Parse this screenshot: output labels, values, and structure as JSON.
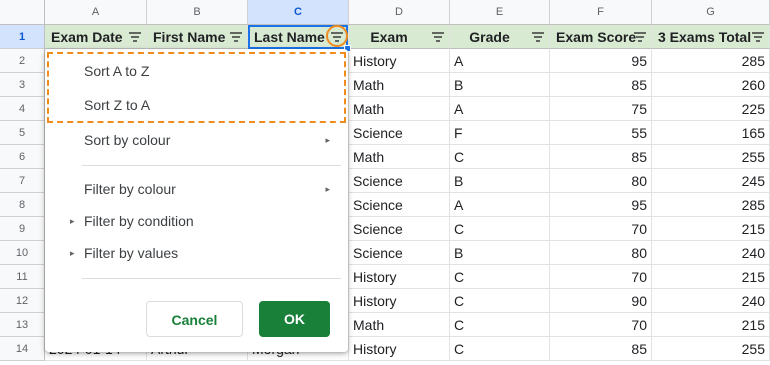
{
  "columns": [
    "A",
    "B",
    "C",
    "D",
    "E",
    "F",
    "G"
  ],
  "selected_column": "C",
  "selected_row": "1",
  "header_row": {
    "row_number": "1",
    "cells": [
      "Exam Date",
      "First Name",
      "Last Name",
      "Exam",
      "Grade",
      "Exam Score",
      "3 Exams Total"
    ]
  },
  "rows": [
    {
      "n": "2",
      "exam": "History",
      "grade": "A",
      "score": "95",
      "total": "285"
    },
    {
      "n": "3",
      "exam": "Math",
      "grade": "B",
      "score": "85",
      "total": "260"
    },
    {
      "n": "4",
      "exam": "Math",
      "grade": "A",
      "score": "75",
      "total": "225"
    },
    {
      "n": "5",
      "exam": "Science",
      "grade": "F",
      "score": "55",
      "total": "165"
    },
    {
      "n": "6",
      "exam": "Math",
      "grade": "C",
      "score": "85",
      "total": "255"
    },
    {
      "n": "7",
      "exam": "Science",
      "grade": "B",
      "score": "80",
      "total": "245"
    },
    {
      "n": "8",
      "exam": "Science",
      "grade": "A",
      "score": "95",
      "total": "285"
    },
    {
      "n": "9",
      "exam": "Science",
      "grade": "C",
      "score": "70",
      "total": "215"
    },
    {
      "n": "10",
      "exam": "Science",
      "grade": "B",
      "score": "80",
      "total": "240"
    },
    {
      "n": "11",
      "exam": "History",
      "grade": "C",
      "score": "70",
      "total": "215"
    },
    {
      "n": "12",
      "exam": "History",
      "grade": "C",
      "score": "90",
      "total": "240"
    },
    {
      "n": "13",
      "exam": "Math",
      "grade": "C",
      "score": "70",
      "total": "215"
    },
    {
      "n": "14",
      "exam": "History",
      "grade": "C",
      "score": "85",
      "total": "255",
      "date": "2024-01-14",
      "first": "Arthur",
      "last": "Morgan"
    }
  ],
  "menu": {
    "sort_az": "Sort A to Z",
    "sort_za": "Sort Z to A",
    "sort_by_colour": "Sort by colour",
    "filter_by_colour": "Filter by colour",
    "filter_by_condition": "Filter by condition",
    "filter_by_values": "Filter by values",
    "cancel": "Cancel",
    "ok": "OK",
    "submenu_arrow": "▸",
    "expand_arrow": "▸"
  },
  "colors": {
    "header_fill": "#d9ead3",
    "highlight": "#f08c1e",
    "accent_green": "#188038",
    "selection_blue": "#1a73e8"
  },
  "icons": {
    "filter": "filter-icon",
    "submenu": "chevron-right-icon",
    "expand": "expand-triangle-icon"
  }
}
